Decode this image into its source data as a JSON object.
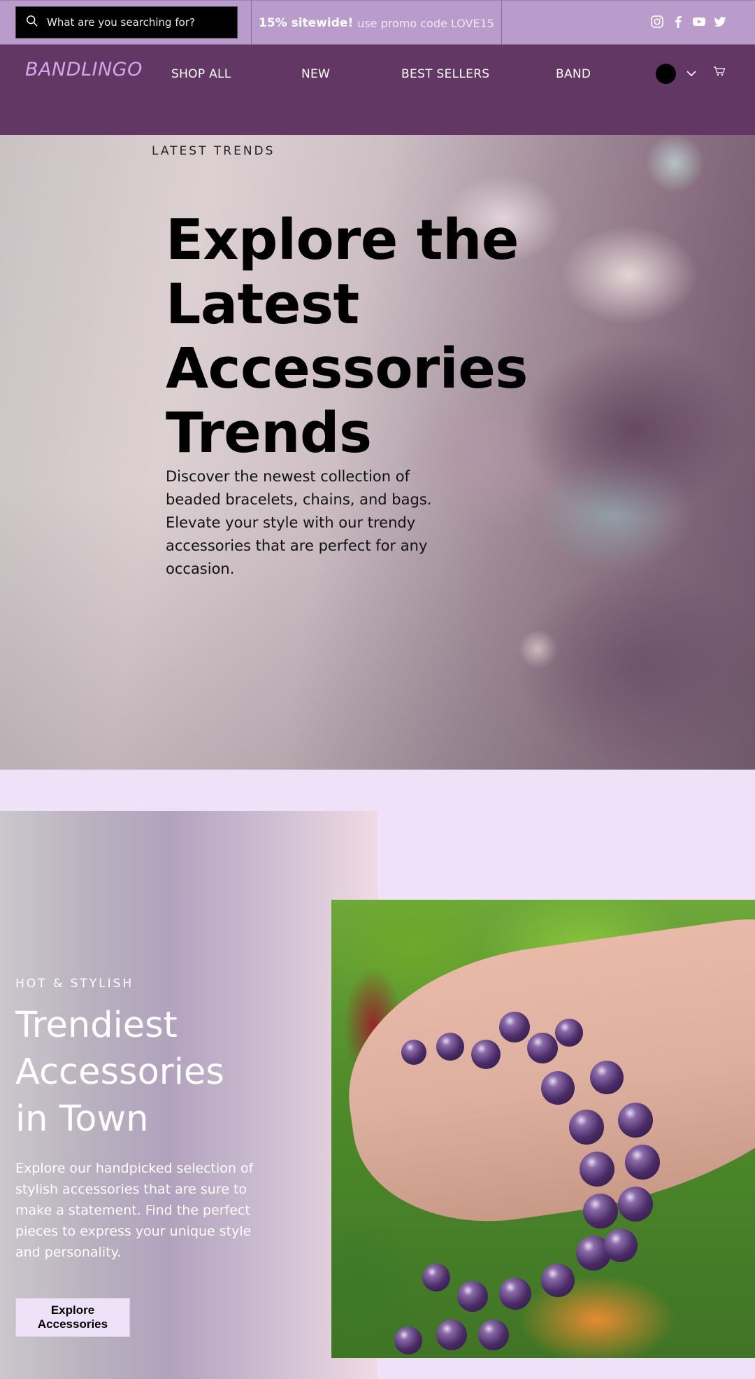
{
  "topbar": {
    "search_placeholder": "What are you searching for?",
    "promo_bold": "15% sitewide!",
    "promo_text": "use promo code LOVE15",
    "socials": [
      "instagram-icon",
      "facebook-icon",
      "youtube-icon",
      "twitter-icon"
    ]
  },
  "nav": {
    "logo": "BANDLINGO",
    "items": [
      "SHOP ALL",
      "NEW",
      "BEST SELLERS",
      "BAND"
    ]
  },
  "hero": {
    "eyebrow": "LATEST TRENDS",
    "title": "Explore the Latest Accessories Trends",
    "description": "Discover the newest collection of beaded bracelets, chains, and bags. Elevate your style with our trendy accessories that are perfect for any occasion."
  },
  "feature": {
    "eyebrow": "HOT & STYLISH",
    "title": "Trendiest Accessories in Town",
    "description": "Explore our handpicked selection of stylish accessories that are sure to make a statement. Find the perfect pieces to express your unique style and personality.",
    "button_label": "Explore Accessories"
  },
  "colors": {
    "topbar": "#b99ccb",
    "nav": "#633763",
    "logo": "#d6a4e8",
    "page_bg": "#efe2f8"
  }
}
